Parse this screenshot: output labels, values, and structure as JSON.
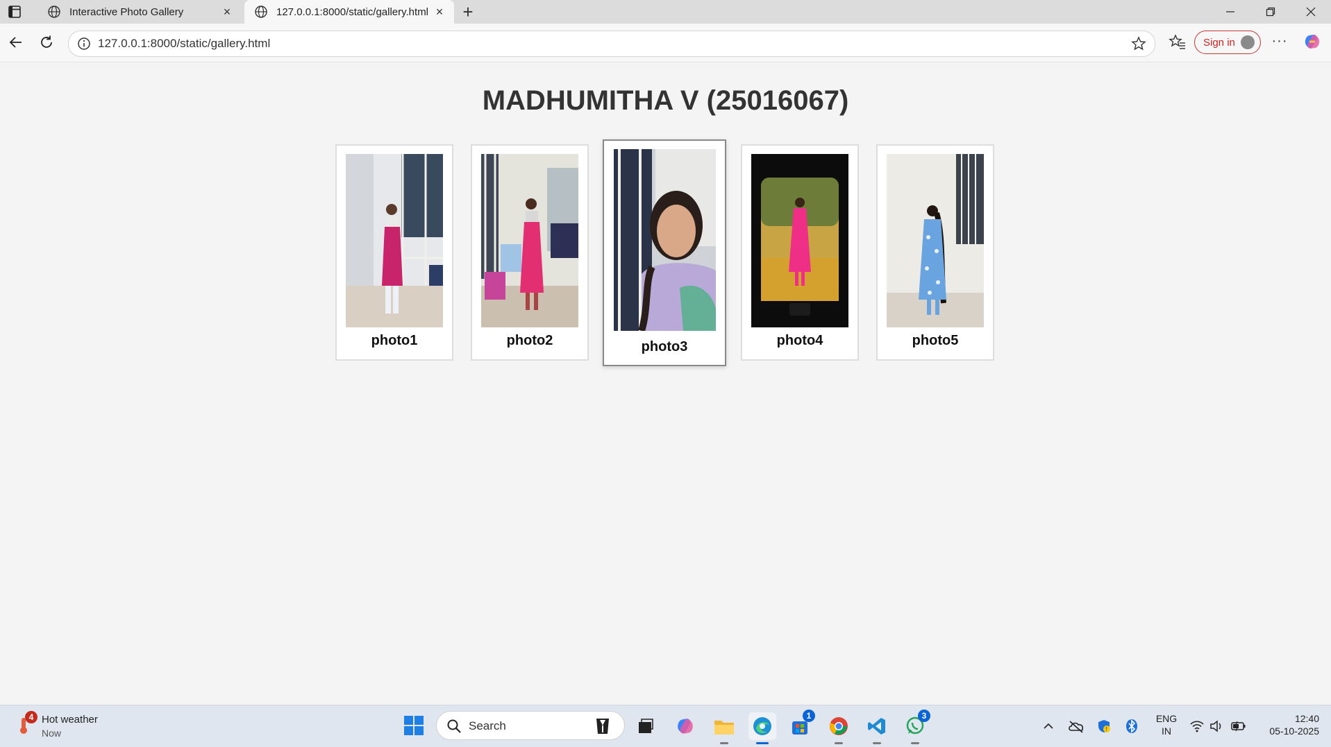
{
  "browser": {
    "tabs": [
      {
        "label": "Interactive Photo Gallery"
      },
      {
        "label": "127.0.0.1:8000/static/gallery.html"
      }
    ],
    "address": "127.0.0.1:8000/static/gallery.html",
    "signin_label": "Sign in"
  },
  "page": {
    "title": "MADHUMITHA V (25016067)",
    "photos": [
      {
        "caption": "photo1"
      },
      {
        "caption": "photo2"
      },
      {
        "caption": "photo3"
      },
      {
        "caption": "photo4"
      },
      {
        "caption": "photo5"
      }
    ]
  },
  "taskbar": {
    "weather_title": "Hot weather",
    "weather_sub": "Now",
    "weather_badge": "4",
    "search_placeholder": "Search",
    "store_badge": "1",
    "whatsapp_badge": "3",
    "lang_line1": "ENG",
    "lang_line2": "IN",
    "time": "12:40",
    "date": "05-10-2025"
  },
  "colors": {
    "accent": "#0a64d6",
    "signin_border": "#cc3333",
    "page_bg": "#f4f4f4"
  }
}
